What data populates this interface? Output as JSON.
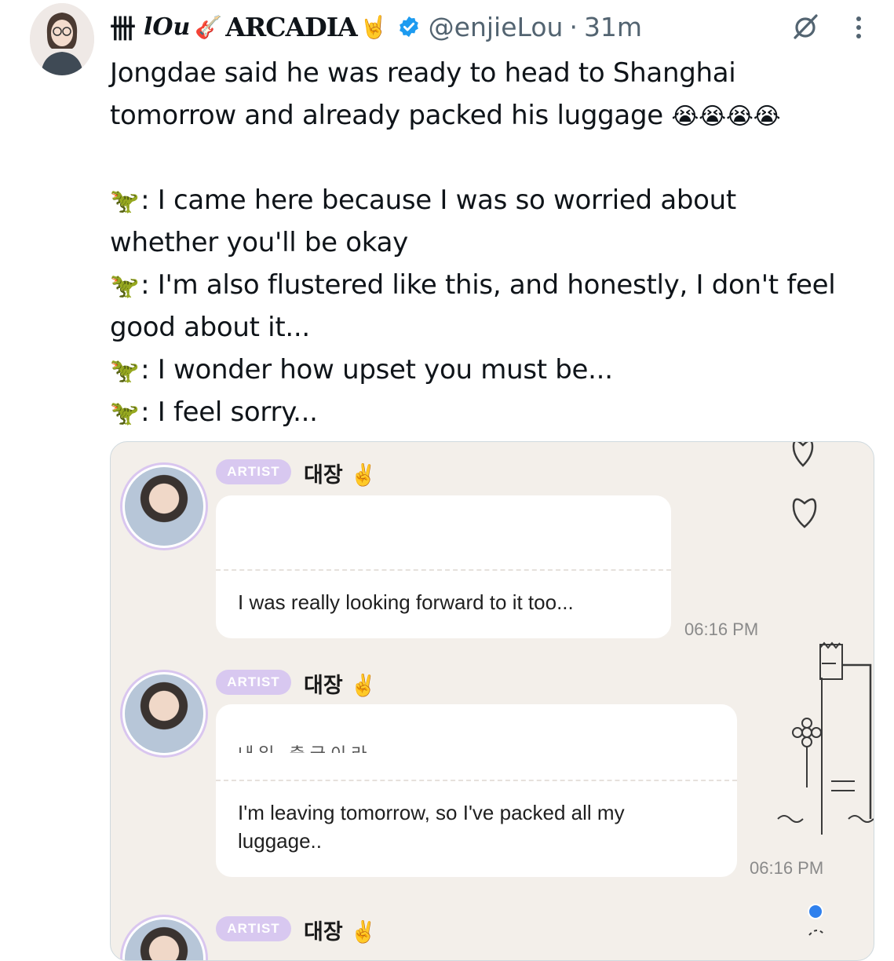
{
  "tweet": {
    "header": {
      "display_name_prefix_glyph": "卌",
      "display_name_lou": "lOu",
      "guitar_emoji": "🎸",
      "display_name_main": "ARCADIA",
      "rock_emoji": "🤘",
      "handle": "@enjieLou",
      "separator": "·",
      "time": "31m"
    },
    "text_lines": {
      "l1": "Jongdae said he was ready to head to Shanghai",
      "l2": "tomorrow and already packed his luggage",
      "l2_emoji": "😭😭😭😭",
      "dino": "🦖",
      "q1a": ": I came here because I was so worried about",
      "q1b": "whether you'll be okay",
      "q2a": ": I'm also flustered like this, and honestly, I don't feel",
      "q2b": "good about it...",
      "q3": ": I wonder how upset you must be...",
      "q4": ": I feel sorry..."
    },
    "icons": {
      "avatar": "profile-photo",
      "verified": "verified-badge-icon",
      "grok": "grok-icon",
      "more": "more-dots-icon"
    },
    "colors": {
      "text": "#0f1419",
      "muted": "#536471",
      "verified": "#1d9bf0",
      "artist_badge": "#d8c8f0",
      "media_bg": "#f3efea"
    }
  },
  "media": {
    "posts": [
      {
        "badge": "ARTIST",
        "name": "대장",
        "name_emoji": "✌️",
        "original": "",
        "translation": "I was really looking forward to it too...",
        "time": "06:16 PM"
      },
      {
        "badge": "ARTIST",
        "name": "대장",
        "name_emoji": "✌️",
        "original": "내일 출국이라",
        "translation_l1": "I'm leaving tomorrow, so I've packed all my",
        "translation_l2": "luggage..",
        "time": "06:16 PM"
      },
      {
        "badge": "ARTIST",
        "name": "대장",
        "name_emoji": "✌️"
      }
    ]
  }
}
